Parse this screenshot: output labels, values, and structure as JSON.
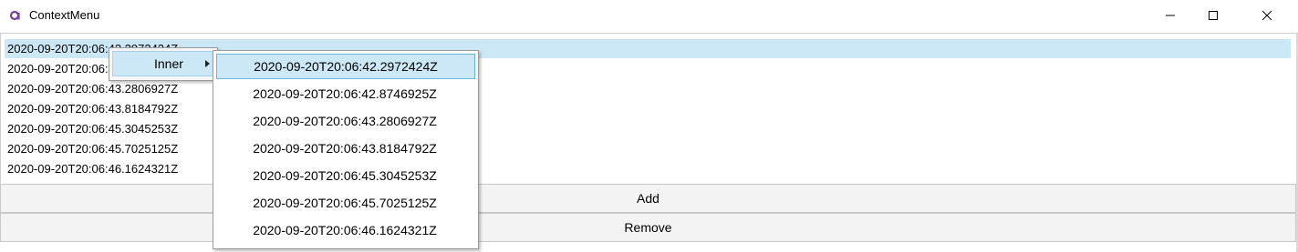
{
  "window": {
    "title": "ContextMenu",
    "accent_color": "#7b3fa0",
    "controls": [
      "minimize-icon",
      "maximize-icon",
      "close-icon"
    ]
  },
  "list": {
    "selected_index": 0,
    "items": [
      "2020-09-20T20:06:42.2972424Z",
      "2020-09-20T20:06:42.8746925Z",
      "2020-09-20T20:06:43.2806927Z",
      "2020-09-20T20:06:43.8184792Z",
      "2020-09-20T20:06:45.3045253Z",
      "2020-09-20T20:06:45.7025125Z",
      "2020-09-20T20:06:46.1624321Z"
    ]
  },
  "context_menu": {
    "item_label": "Inner",
    "submenu_icon": "submenu-arrow-icon"
  },
  "submenu": {
    "highlighted_index": 0,
    "items": [
      "2020-09-20T20:06:42.2972424Z",
      "2020-09-20T20:06:42.8746925Z",
      "2020-09-20T20:06:43.2806927Z",
      "2020-09-20T20:06:43.8184792Z",
      "2020-09-20T20:06:45.3045253Z",
      "2020-09-20T20:06:45.7025125Z",
      "2020-09-20T20:06:46.1624321Z"
    ]
  },
  "buttons": {
    "add_label": "Add",
    "remove_label": "Remove"
  }
}
